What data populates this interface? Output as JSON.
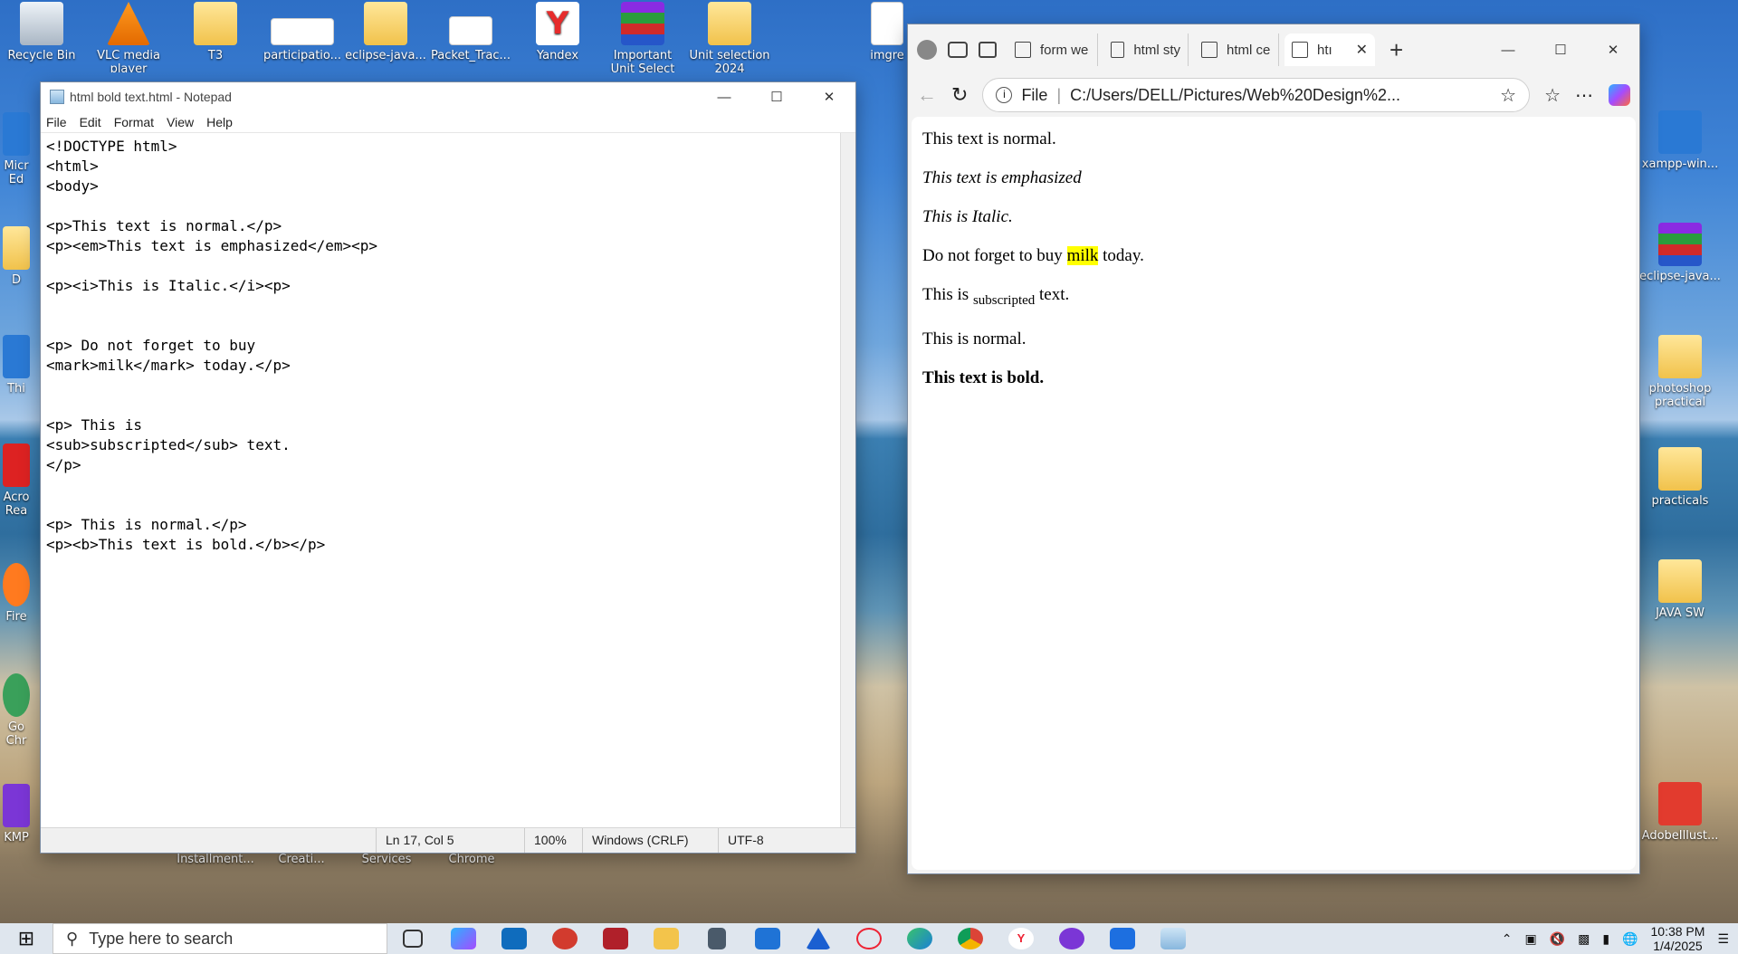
{
  "desktop": {
    "icons": [
      {
        "label": "Recycle Bin",
        "icon": "recycle-bin-icon"
      },
      {
        "label": "VLC media player",
        "icon": "vlc-icon"
      },
      {
        "label": "T3",
        "icon": "folder-icon"
      },
      {
        "label": "participatio...",
        "icon": "document-icon"
      },
      {
        "label": "eclipse-java...",
        "icon": "folder-icon"
      },
      {
        "label": "Packet_Trac...",
        "icon": "envelope-icon"
      },
      {
        "label": "Yandex",
        "icon": "yandex-icon"
      },
      {
        "label": "Important Unit Select",
        "icon": "winrar-icon"
      },
      {
        "label": "Unit selection 2024",
        "icon": "folder-icon"
      },
      {
        "label": "imgre",
        "icon": "html-file-icon"
      },
      {
        "label": "xampp-win...",
        "icon": "xampp-icon"
      },
      {
        "label": "eclipse-java...",
        "icon": "winrar-icon"
      },
      {
        "label": "photoshop practical",
        "icon": "folder-icon"
      },
      {
        "label": "practicals",
        "icon": "folder-icon"
      },
      {
        "label": "JAVA SW",
        "icon": "folder-icon"
      },
      {
        "label": "AdobeIllust...",
        "icon": "pdf-icon"
      },
      {
        "label": "Installment...",
        "icon": "folder-icon"
      },
      {
        "label": "Creati...",
        "icon": "folder-icon"
      },
      {
        "label": "Services",
        "icon": "folder-icon"
      },
      {
        "label": "Chrome",
        "icon": "chrome-icon"
      },
      {
        "label": "Micr Ed",
        "icon": "edge-icon"
      },
      {
        "label": "D",
        "icon": "folder-icon"
      },
      {
        "label": "Thi",
        "icon": "pc-icon"
      },
      {
        "label": "Acro Rea",
        "icon": "acrobat-icon"
      },
      {
        "label": "Fire",
        "icon": "firefox-icon"
      },
      {
        "label": "Go Chr",
        "icon": "chrome-icon"
      },
      {
        "label": "KMP",
        "icon": "kmplayer-icon"
      }
    ]
  },
  "notepad": {
    "title": "html bold text.html - Notepad",
    "menu": [
      "File",
      "Edit",
      "Format",
      "View",
      "Help"
    ],
    "content": "<!DOCTYPE html>\n<html>\n<body>\n\n<p>This text is normal.</p>\n<p><em>This text is emphasized</em><p>\n\n<p><i>This is Italic.</i><p>\n\n\n<p> Do not forget to buy\n<mark>milk</mark> today.</p>\n\n\n<p> This is\n<sub>subscripted</sub> text.\n</p>\n\n\n<p> This is normal.</p>\n<p><b>This text is bold.</b></p>",
    "status": {
      "position": "Ln 17, Col 5",
      "zoom": "100%",
      "line_ending": "Windows (CRLF)",
      "encoding": "UTF-8"
    }
  },
  "browser": {
    "tabs": [
      "form we",
      "html sty",
      "html ce",
      "htı"
    ],
    "url_scheme": "File",
    "url": "C:/Users/DELL/Pictures/Web%20Design%2...",
    "page": {
      "p1": "This text is normal.",
      "p2": "This text is emphasized",
      "p3": "This is Italic.",
      "p4_before": "Do not forget to buy ",
      "p4_mark": "milk",
      "p4_after": " today.",
      "p5_before": "This is ",
      "p5_sub": "subscripted",
      "p5_after": " text.",
      "p6": "This is normal.",
      "p7": "This text is bold."
    }
  },
  "taskbar": {
    "search_placeholder": "Type here to search",
    "time": "10:38 PM",
    "date": "1/4/2025"
  },
  "colors": {
    "mark_highlight": "#ffff00",
    "taskbar": "#dfe6ee"
  }
}
